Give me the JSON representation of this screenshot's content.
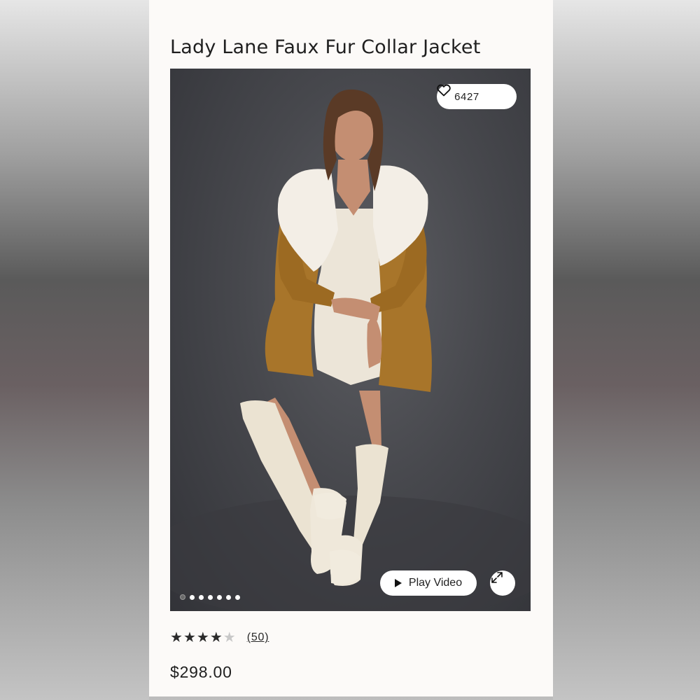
{
  "product": {
    "title": "Lady Lane Faux Fur Collar Jacket",
    "price": "$298.00",
    "favorites_count": "6427",
    "rating": {
      "value": 4,
      "max": 5,
      "reviews_label": "(50)"
    }
  },
  "gallery": {
    "image_count": 7,
    "active_index": 0,
    "play_video_label": "Play Video",
    "icons": {
      "favorite": "heart-icon",
      "play": "play-icon",
      "expand": "expand-icon"
    }
  },
  "colors": {
    "card_background": "#fcfaf8",
    "photo_backdrop": "#47484d",
    "jacket": "#a8752a",
    "fur_collar": "#f3eee6",
    "text": "#1f1f1f"
  }
}
